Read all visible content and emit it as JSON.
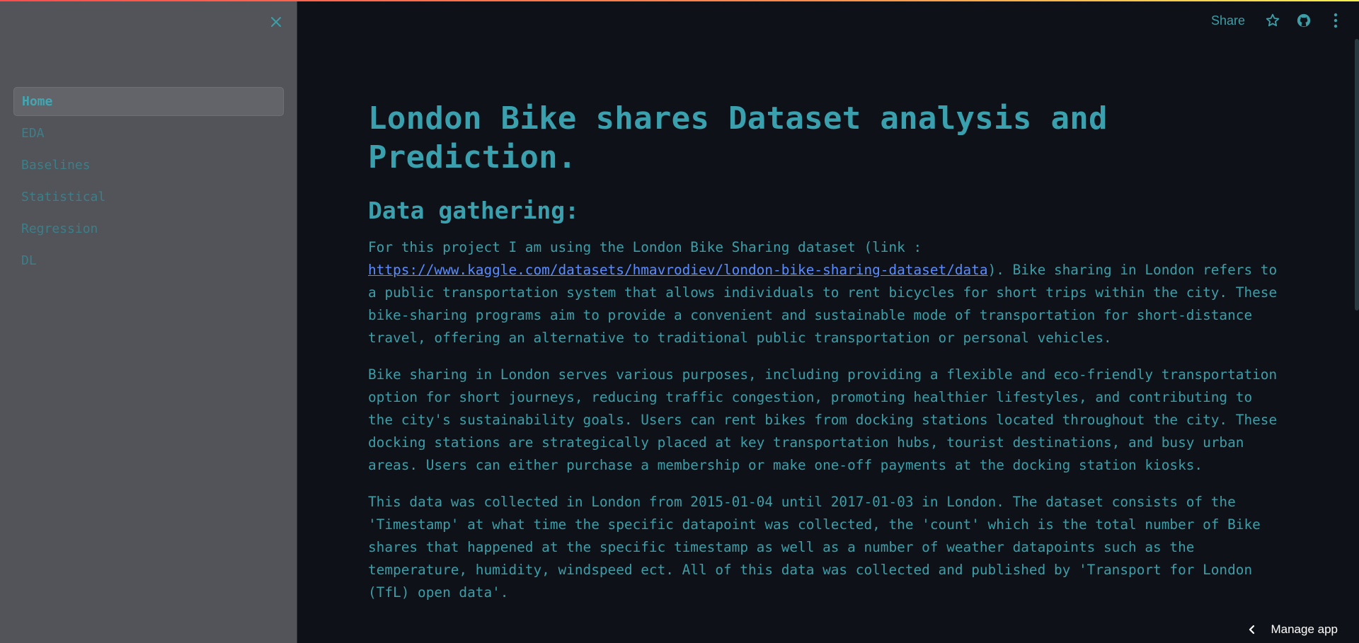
{
  "sidebar": {
    "items": [
      {
        "label": "Home",
        "active": true
      },
      {
        "label": "EDA",
        "active": false
      },
      {
        "label": "Baselines",
        "active": false
      },
      {
        "label": "Statistical",
        "active": false
      },
      {
        "label": "Regression",
        "active": false
      },
      {
        "label": "DL",
        "active": false
      }
    ]
  },
  "header": {
    "share_label": "Share",
    "icons": [
      "star-icon",
      "github-icon",
      "more-vertical-icon"
    ]
  },
  "main": {
    "title": "London Bike shares Dataset analysis and Prediction.",
    "section_title": "Data gathering:",
    "p1_before": "For this project I am using the London Bike Sharing dataset (link :",
    "p1_link": "https://www.kaggle.com/datasets/hmavrodiev/london-bike-sharing-dataset/data",
    "p1_after": "). Bike sharing in London refers to a public transportation system that allows individuals to rent bicycles for short trips within the city. These bike-sharing programs aim to provide a convenient and sustainable mode of transportation for short-distance travel, offering an alternative to traditional public transportation or personal vehicles.",
    "p2": "Bike sharing in London serves various purposes, including providing a flexible and eco-friendly transportation option for short journeys, reducing traffic congestion, promoting healthier lifestyles, and contributing to the city's sustainability goals. Users can rent bikes from docking stations located throughout the city. These docking stations are strategically placed at key transportation hubs, tourist destinations, and busy urban areas. Users can either purchase a membership or make one-off payments at the docking station kiosks.",
    "p3": "This data was collected in London from 2015-01-04 until 2017-01-03 in London. The dataset consists of the 'Timestamp' at what time the specific datapoint was collected, the 'count' which is the total number of Bike shares that happened at the specific timestamp as well as a number of weather datapoints such as the temperature, humidity, windspeed ect. All of this data was collected and published by 'Transport for London (TfL) open data'."
  },
  "footer": {
    "manage_app_label": "Manage app"
  },
  "colors": {
    "background": "#0e1117",
    "sidebar": "#52545a",
    "text": "#3d9ea8",
    "link": "#5b8cff"
  }
}
